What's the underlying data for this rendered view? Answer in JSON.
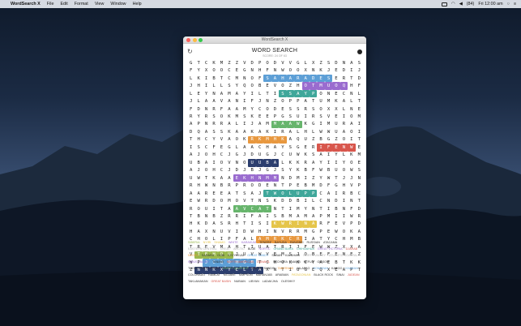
{
  "menubar": {
    "app": "WordSearch X",
    "items": [
      "File",
      "Edit",
      "Format",
      "View",
      "Window",
      "Help"
    ],
    "battery": "(84)",
    "clock": "Fri 12:00 am"
  },
  "window": {
    "title": "WordSearch X",
    "heading": "WORD SEARCH",
    "subheading": "SCORE: 24 OF 63"
  },
  "colors": {
    "blue": "#5d9fd6",
    "purple": "#9a6ccf",
    "teal": "#3fa79a",
    "green": "#67b56c",
    "orange": "#e8983f",
    "navy": "#2c3e6e",
    "lime": "#9ab84d",
    "gray": "#b0b0b0",
    "yellow": "#e5c54a",
    "red": "#d8564c"
  },
  "grid": [
    "GTCKMZZVDPODVVGLXZSDNASAHIHAWK",
    "FYXOOCEGNHFNWOOXNKJEDIJELNEOO",
    "LKIBTCMNOFSAHARADESERTDNCOUTOPT",
    "JHILLSYQOBEVOZHOTMUOQHFQXSOQ",
    "LEYNAMAYILTISSAYPONECNLVCEKHFV",
    "JLAAVANIFJNZOPPATUMKALTIBEDDB",
    "FDNRFAAMYCODESSRSOXXLNEOIERV",
    "RYRSOKMSKEEPGSUIRSVEIOMDSJ",
    "APNRRALIJAMMAAWKGIMURAIQHT",
    "DQASSKAAKAKIRALHLWWUAOIXLQ",
    "THCYVAOKRKMHKAQUZBGZOITLYKOWJ",
    "ISCFEGLAACHAYSGERIFENWERAVPFW",
    "AJOHCJGJDUGJCUWKSAIYLKMNARU",
    "UBAIOVNOUUBALKKRAYIIYOERSLORT",
    "AJOHCJDJBJGJSYKBFWBUOWSATA",
    "UWTKAAEKHNMMNDMIZYWTJJNUDE",
    "RHWNBRPRODENTPEBMDFGHVPKFVE",
    "AAREEATSAJTWOLUPPCAIRBCHQACKAA",
    "EWRDOMOVTNSKDDBILCNDINTHMEI",
    "ROUITAAVCATNTIMYNTIBNFDMMP",
    "TBNBZRRIFAISBMAMAPMIIWRUNKGQ",
    "HKDASRHTISIKWRINARFEVPDDNTRL",
    "HAXNUVIDWHINVRRMGPEWOKAYO",
    "CHOLIPFALAMRKCRIATYCHMBMJLZ",
    "TREVMAHTIUATRIJFEWWZXXAKLHV",
    "VTEHQUJUVWVEMSJOBEFENEZFWNRS",
    "WPJCQOHGBTCHOKKCYAEBTKKPEPC",
    "ZNNKXYELTAXNTIUGEQXEAPTMEYYL"
  ],
  "wordlist": [
    {
      "t": "SIBERIA",
      "c": "lime"
    },
    {
      "t": "NYIRI",
      "c": "yellow"
    },
    {
      "t": "SHAMO",
      "c": "yellow"
    },
    {
      "t": "WHITE",
      "c": "purple"
    },
    {
      "t": "KARAKUM",
      "c": "purple"
    },
    {
      "t": "TENERE",
      "c": "dark"
    },
    {
      "t": "BAYUDA",
      "c": "dark"
    },
    {
      "t": "RANGBEI",
      "c": "dark"
    },
    {
      "t": "RUSSIAN",
      "c": "dark"
    },
    {
      "t": "ATACAMA",
      "c": "dark"
    },
    {
      "t": "EASTERN CENTRAL",
      "c": "gray"
    },
    {
      "t": "GREAT",
      "c": "gray"
    },
    {
      "t": "ARCTIC",
      "c": "gray"
    },
    {
      "t": "BLUE",
      "c": "dark"
    },
    {
      "t": "NORTIC",
      "c": "purple"
    },
    {
      "t": "GRAND BARA",
      "c": "teal"
    },
    {
      "t": "CHIHUAHUA",
      "c": "teal"
    },
    {
      "t": "GREAT VICTORIA",
      "c": "purple"
    },
    {
      "t": "DJARAB",
      "c": "red"
    },
    {
      "t": "NEGEV",
      "c": "orange"
    },
    {
      "t": "SAHARA",
      "c": "dark"
    },
    {
      "t": "GOBI",
      "c": "dark"
    },
    {
      "t": "KYZYLKUM",
      "c": "dark"
    },
    {
      "t": "GREAT SANDY",
      "c": "blue"
    },
    {
      "t": "SUBAN",
      "c": "dark"
    },
    {
      "t": "KALAHARI",
      "c": "dark"
    },
    {
      "t": "NORTH VALLEY",
      "c": "gray"
    },
    {
      "t": "ATLANTIC COASTAL",
      "c": "gray"
    },
    {
      "t": "INDUS VALLEY",
      "c": "purple"
    },
    {
      "t": "TANAMI",
      "c": "dark"
    },
    {
      "t": "NORTH AMERICAN",
      "c": "red"
    },
    {
      "t": "DANAKIL",
      "c": "red"
    },
    {
      "t": "SECHURA",
      "c": "dark"
    },
    {
      "t": "NAMIB",
      "c": "dark"
    },
    {
      "t": "NEFUD",
      "c": "dark"
    },
    {
      "t": "GIBSON",
      "c": "dark"
    },
    {
      "t": "THOMPSON PLATEAU",
      "c": "dark"
    },
    {
      "t": "EMPTY QUARTER",
      "c": "green"
    },
    {
      "t": "WAHIBA SANDS",
      "c": "dark"
    },
    {
      "t": "TABERNAS",
      "c": "orange"
    },
    {
      "t": "JALAPAO",
      "c": "dark"
    },
    {
      "t": "SONORAN",
      "c": "blue"
    },
    {
      "t": "KAROO",
      "c": "dark"
    },
    {
      "t": "KHARAN",
      "c": "blue"
    },
    {
      "t": "COLORADO",
      "c": "dark"
    },
    {
      "t": "RAMLAT",
      "c": "dark"
    },
    {
      "t": "MOJAVE",
      "c": "dark"
    },
    {
      "t": "SIMPSON",
      "c": "dark"
    },
    {
      "t": "MARANJAB",
      "c": "dark"
    },
    {
      "t": "ARABIAN",
      "c": "dark"
    },
    {
      "t": "PATAGONIAN",
      "c": "yellow"
    },
    {
      "t": "BLACK ROCK",
      "c": "dark"
    },
    {
      "t": "SINAI",
      "c": "dark"
    },
    {
      "t": "JUDEAN",
      "c": "red"
    },
    {
      "t": "TAKLAMAKAN",
      "c": "dark"
    },
    {
      "t": "GREAT BASIN",
      "c": "red"
    },
    {
      "t": "NUBIAN",
      "c": "dark"
    },
    {
      "t": "LIBYAN",
      "c": "dark"
    },
    {
      "t": "LADAKJHA",
      "c": "dark"
    },
    {
      "t": "OLESHKY",
      "c": "dark"
    }
  ]
}
